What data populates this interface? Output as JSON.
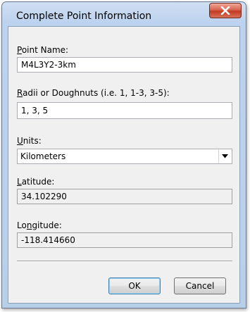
{
  "window": {
    "title": "Complete Point Information"
  },
  "fields": {
    "point_name": {
      "label_accel": "P",
      "label_rest": "oint Name:",
      "value": "M4L3Y2-3km"
    },
    "radii": {
      "label_accel": "R",
      "label_rest": "adii or Doughnuts (i.e. 1, 1-3, 3-5):",
      "value": "1, 3, 5"
    },
    "units": {
      "label_accel": "U",
      "label_rest": "nits:",
      "selected": "Kilometers"
    },
    "latitude": {
      "label_accel": "L",
      "label_rest": "atitude:",
      "value": "34.102290"
    },
    "longitude": {
      "label_pre": "Lo",
      "label_accel": "n",
      "label_rest": "gitude:",
      "value": "-118.414660"
    }
  },
  "buttons": {
    "ok": "OK",
    "cancel": "Cancel"
  },
  "icons": {
    "close": "close-icon",
    "dropdown": "chevron-down-icon"
  }
}
